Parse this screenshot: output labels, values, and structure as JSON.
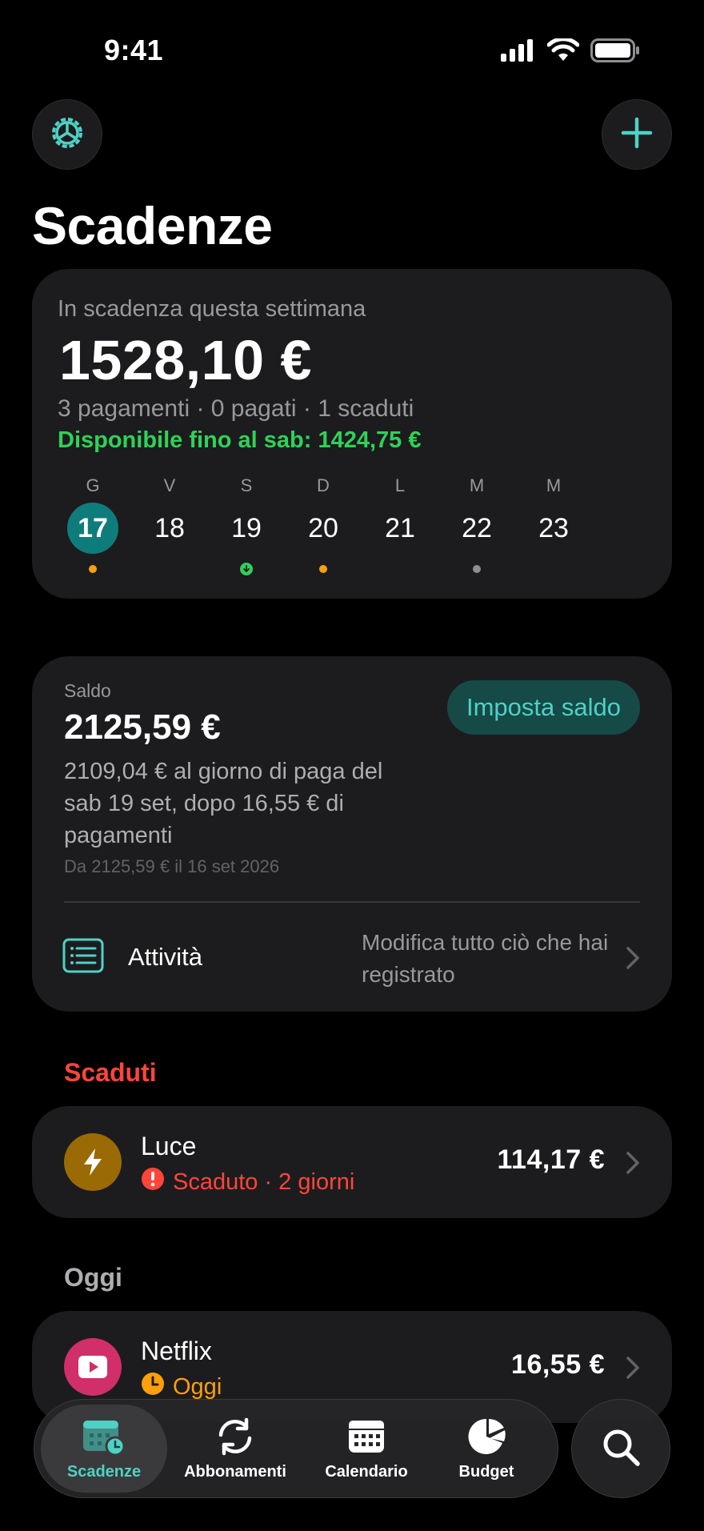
{
  "status_bar": {
    "time": "9:41"
  },
  "header": {
    "title": "Scadenze"
  },
  "week": {
    "label": "In scadenza questa settimana",
    "total": "1528,10 €",
    "counts": "3 pagamenti · 0 pagati · 1 scaduti",
    "available": "Disponibile fino al sab: 1424,75 €",
    "days": [
      {
        "letter": "G",
        "number": "17",
        "active": true,
        "dot": "orange"
      },
      {
        "letter": "V",
        "number": "18",
        "active": false,
        "dot": ""
      },
      {
        "letter": "S",
        "number": "19",
        "active": false,
        "dot": "green"
      },
      {
        "letter": "D",
        "number": "20",
        "active": false,
        "dot": "orange"
      },
      {
        "letter": "L",
        "number": "21",
        "active": false,
        "dot": ""
      },
      {
        "letter": "M",
        "number": "22",
        "active": false,
        "dot": "grey"
      },
      {
        "letter": "M",
        "number": "23",
        "active": false,
        "dot": ""
      }
    ]
  },
  "saldo": {
    "label": "Saldo",
    "amount": "2125,59 €",
    "description": "2109,04 € al giorno di paga del sab 19 set, dopo 16,55 € di pagamenti",
    "since": "Da 2125,59 € il 16 set 2026",
    "set_button": "Imposta saldo",
    "activity_label": "Attività",
    "activity_desc": "Modifica tutto ciò che hai registrato"
  },
  "sections": {
    "overdue": "Scaduti",
    "today": "Oggi"
  },
  "bills": {
    "luce": {
      "name": "Luce",
      "status": "Scaduto · 2 giorni",
      "amount": "114,17 €",
      "status_color": "#ff453a",
      "icon_color": "#9a6a05"
    },
    "netflix": {
      "name": "Netflix",
      "status": "Oggi",
      "amount": "16,55 €",
      "status_color": "#ff9f0a",
      "icon_color": "#d12f6a"
    }
  },
  "tabs": [
    {
      "label": "Scadenze",
      "icon": "calendar-clock-icon",
      "active": true
    },
    {
      "label": "Abbonamenti",
      "icon": "refresh-icon",
      "active": false
    },
    {
      "label": "Calendario",
      "icon": "calendar-icon",
      "active": false
    },
    {
      "label": "Budget",
      "icon": "pie-chart-icon",
      "active": false
    }
  ],
  "colors": {
    "accent": "#4fd1c5",
    "positive": "#30d158",
    "negative": "#ff453a",
    "warning": "#ff9f0a"
  }
}
